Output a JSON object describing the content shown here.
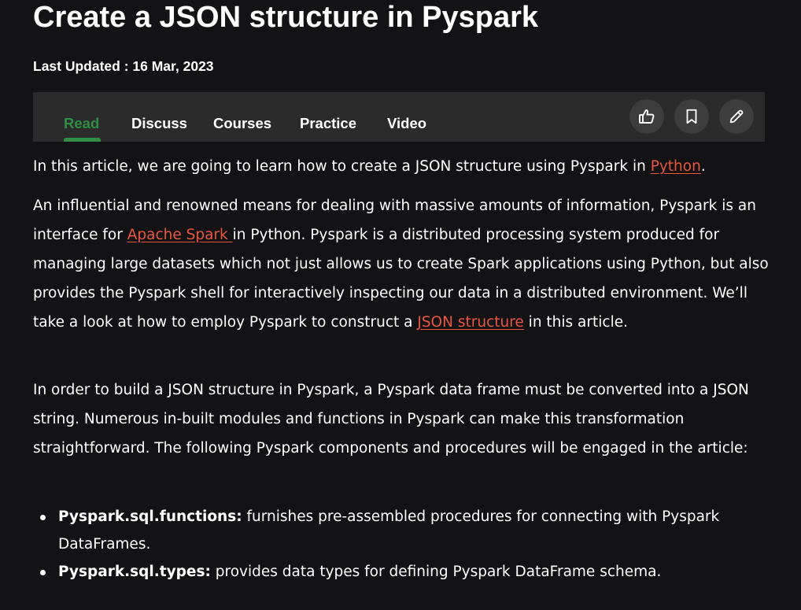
{
  "article": {
    "title": "Create a JSON structure in Pyspark",
    "last_updated": "Last Updated : 16 Mar, 2023"
  },
  "tabs": [
    {
      "label": "Read",
      "active": true
    },
    {
      "label": "Discuss",
      "active": false
    },
    {
      "label": "Courses",
      "active": false
    },
    {
      "label": "Practice",
      "active": false
    },
    {
      "label": "Video",
      "active": false
    }
  ],
  "actions": [
    {
      "icon": "thumbs-up-icon"
    },
    {
      "icon": "bookmark-icon"
    },
    {
      "icon": "pencil-icon"
    }
  ],
  "paragraphs": {
    "p1_before": "In this article, we are going to learn how to create a JSON structure using Pyspark in ",
    "p1_link": "Python",
    "p1_after": ".",
    "p2_before": "An influential and renowned means for dealing with massive amounts of information, Pyspark is an interface for ",
    "p2_link1": "Apache Spark ",
    "p2_middle": "in Python. Pyspark is a distributed processing system produced for managing large datasets which not just allows us to create Spark applications using Python, but also provides the Pyspark shell for interactively inspecting our data in a distributed environment. We’ll take a look at how to employ Pyspark to construct a ",
    "p2_link2": "JSON structure",
    "p2_after": " in this article.",
    "p3": "In order to build a JSON structure in Pyspark, a Pyspark data frame must be converted into a JSON string. Numerous in-built modules and functions in Pyspark can make this transformation straightforward. The following Pyspark components and procedures will be engaged in the article:"
  },
  "bullets": [
    {
      "term": "Pyspark.sql.functions:",
      "text": " furnishes pre-assembled procedures for connecting with Pyspark DataFrames."
    },
    {
      "term": "Pyspark.sql.types:",
      "text": " provides data types for defining Pyspark DataFrame schema."
    }
  ],
  "colors": {
    "background": "#131316",
    "tabbar": "#2b2b2b",
    "active_tab": "#2f8d46",
    "link": "#e9553f",
    "icon_button": "#3d3d3d"
  }
}
